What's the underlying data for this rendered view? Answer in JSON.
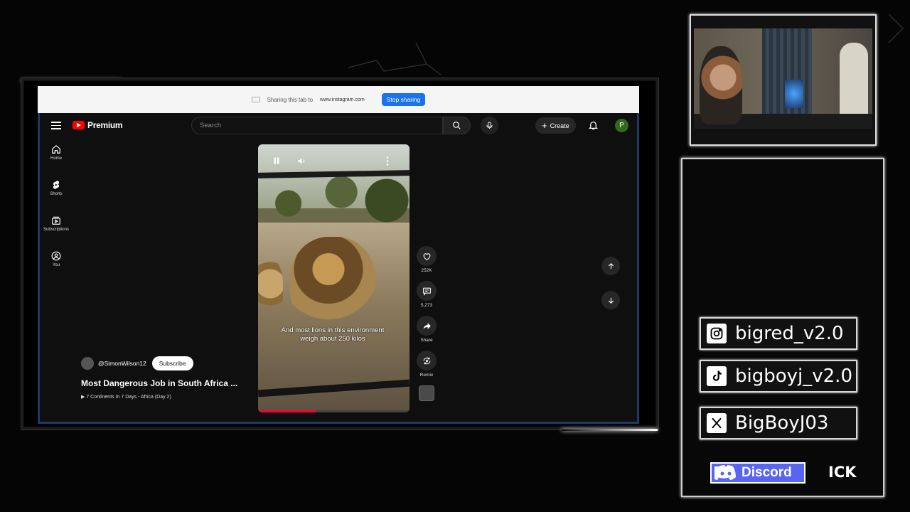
{
  "share_bar": {
    "text": "Sharing this tab to",
    "url": "www.instagram.com",
    "stop_label": "Stop sharing"
  },
  "youtube": {
    "logo_text": "Premium",
    "search_placeholder": "Search",
    "create_label": "Create",
    "avatar_letter": "P",
    "sidebar": [
      {
        "label": "Home",
        "icon": "home-icon"
      },
      {
        "label": "Shorts",
        "icon": "shorts-icon"
      },
      {
        "label": "Subscriptions",
        "icon": "subscriptions-icon"
      },
      {
        "label": "You",
        "icon": "you-icon"
      }
    ],
    "video": {
      "caption": "And most lions in this environment weigh about 250 kilos",
      "progress": 0.38
    },
    "actions": [
      {
        "label": "252K",
        "icon": "like-icon"
      },
      {
        "label": "5,273",
        "icon": "comment-icon"
      },
      {
        "label": "Share",
        "icon": "share-icon"
      },
      {
        "label": "Remix",
        "icon": "remix-icon"
      }
    ],
    "channel": "@SimonWilson12",
    "subscribe_label": "Subscribe",
    "title": "Most Dangerous Job in South Africa ...",
    "playlist": "7 Continents In 7 Days - Africa (Day 2)"
  },
  "socials": [
    {
      "platform": "instagram",
      "icon": "instagram-icon",
      "handle": "bigred_v2.0"
    },
    {
      "platform": "tiktok",
      "icon": "tiktok-icon",
      "handle": "bigboyj_v2.0"
    },
    {
      "platform": "x",
      "icon": "x-icon",
      "handle": "BigBoyJ03"
    }
  ],
  "discord_label": "Discord",
  "ick_label": "ICK",
  "colors": {
    "accent": "#1a73e8",
    "youtube_red": "#ff0000",
    "discord": "#5865f2"
  }
}
